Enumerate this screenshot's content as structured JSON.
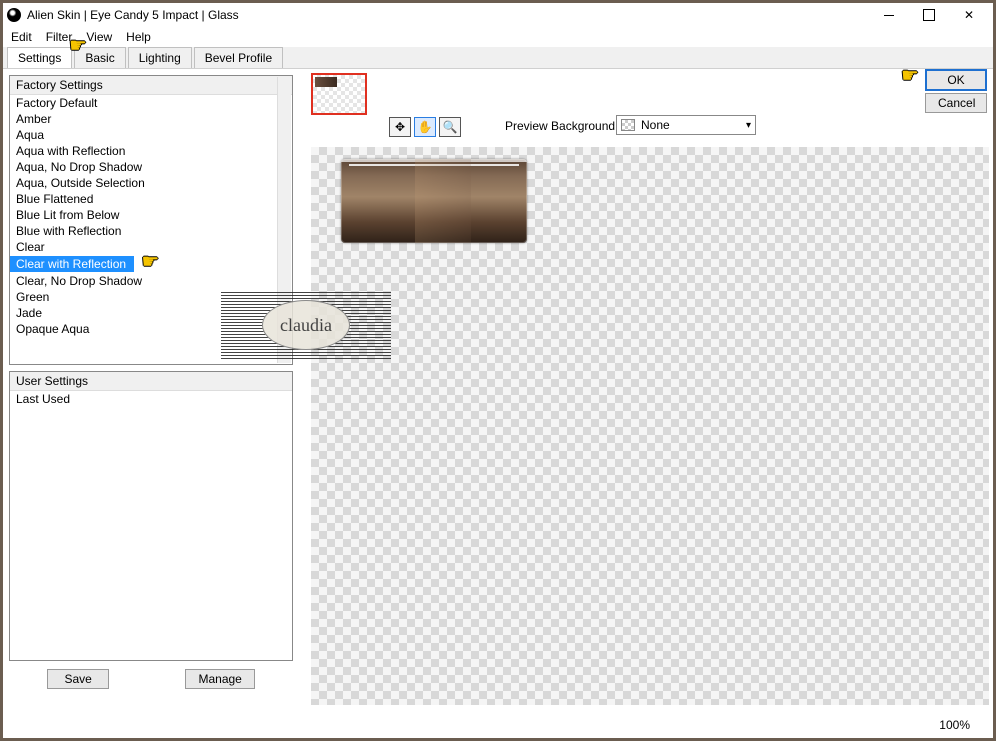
{
  "window": {
    "title": "Alien Skin | Eye Candy 5 Impact | Glass"
  },
  "menubar": {
    "edit": "Edit",
    "filter": "Filter",
    "view": "View",
    "help": "Help"
  },
  "tabs": {
    "settings": "Settings",
    "basic": "Basic",
    "lighting": "Lighting",
    "bevel": "Bevel Profile"
  },
  "factory": {
    "header": "Factory Settings",
    "items": [
      "Factory Default",
      "Amber",
      "Aqua",
      "Aqua with Reflection",
      "Aqua, No Drop Shadow",
      "Aqua, Outside Selection",
      "Blue Flattened",
      "Blue Lit from Below",
      "Blue with Reflection",
      "Clear",
      "Clear with Reflection",
      "Clear, No Drop Shadow",
      "Green",
      "Jade",
      "Opaque Aqua"
    ],
    "selected_index": 10
  },
  "user": {
    "header": "User Settings",
    "items": [
      "Last Used"
    ]
  },
  "buttons": {
    "save": "Save",
    "manage": "Manage",
    "ok": "OK",
    "cancel": "Cancel"
  },
  "preview": {
    "label": "Preview Background:",
    "value": "None"
  },
  "watermark": {
    "text": "claudia"
  },
  "status": {
    "zoom": "100%"
  }
}
